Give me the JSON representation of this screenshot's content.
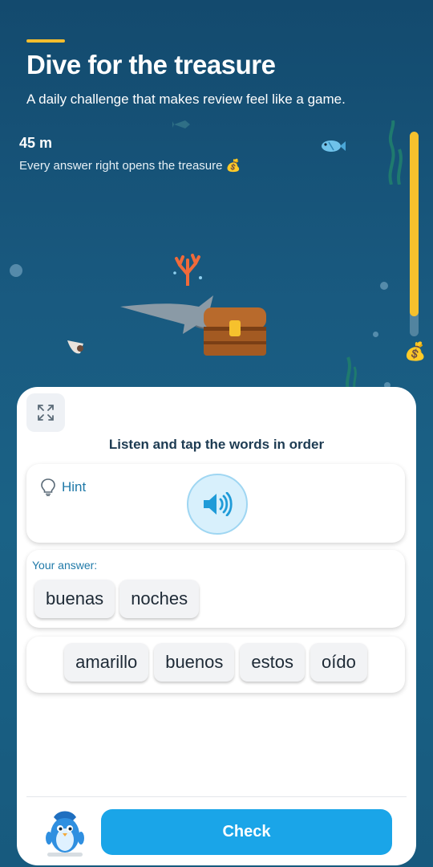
{
  "header": {
    "title": "Dive for the treasure",
    "subtitle": "A daily challenge that makes review feel like a game."
  },
  "game": {
    "depth": "45 m",
    "tagline": "Every answer right opens the treasure",
    "tagline_icon": "money-bag-icon",
    "depth_progress": 0.9,
    "goal_icon": "money-bag-icon"
  },
  "exercise": {
    "instruction": "Listen and tap the words in order",
    "hint_label": "Hint",
    "answer_label": "Your answer:",
    "answer_words": [
      "buenas",
      "noches"
    ],
    "word_bank": [
      "amarillo",
      "buenos",
      "estos",
      "oído"
    ],
    "check_label": "Check"
  },
  "colors": {
    "accent": "#f4bd2e",
    "primary_button": "#1aa5e8",
    "hint_text": "#1f79a8",
    "ocean": "#1a5f86"
  }
}
